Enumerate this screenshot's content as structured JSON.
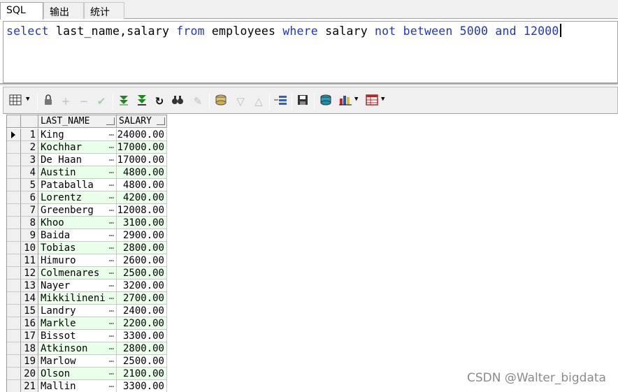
{
  "tabs": [
    "SQL",
    "输出",
    "统计"
  ],
  "sql": {
    "tokens": [
      {
        "t": "select",
        "k": true
      },
      {
        "t": " last_name,salary ",
        "k": false
      },
      {
        "t": "from",
        "k": true
      },
      {
        "t": " employees ",
        "k": false
      },
      {
        "t": "where",
        "k": true
      },
      {
        "t": " salary ",
        "k": false
      },
      {
        "t": "not",
        "k": true
      },
      {
        "t": " ",
        "k": false
      },
      {
        "t": "between",
        "k": true
      },
      {
        "t": " ",
        "k": false
      },
      {
        "t": "5000",
        "k": true
      },
      {
        "t": " ",
        "k": false
      },
      {
        "t": "and",
        "k": true
      },
      {
        "t": " ",
        "k": false
      },
      {
        "t": "12000",
        "k": true
      }
    ]
  },
  "grid": {
    "columns": [
      "LAST_NAME",
      "SALARY"
    ],
    "rows": [
      {
        "n": "1",
        "name": "King",
        "salary": "24000.00"
      },
      {
        "n": "2",
        "name": "Kochhar",
        "salary": "17000.00"
      },
      {
        "n": "3",
        "name": "De Haan",
        "salary": "17000.00"
      },
      {
        "n": "4",
        "name": "Austin",
        "salary": "4800.00"
      },
      {
        "n": "5",
        "name": "Pataballa",
        "salary": "4800.00"
      },
      {
        "n": "6",
        "name": "Lorentz",
        "salary": "4200.00"
      },
      {
        "n": "7",
        "name": "Greenberg",
        "salary": "12008.00"
      },
      {
        "n": "8",
        "name": "Khoo",
        "salary": "3100.00"
      },
      {
        "n": "9",
        "name": "Baida",
        "salary": "2900.00"
      },
      {
        "n": "10",
        "name": "Tobias",
        "salary": "2800.00"
      },
      {
        "n": "11",
        "name": "Himuro",
        "salary": "2600.00"
      },
      {
        "n": "12",
        "name": "Colmenares",
        "salary": "2500.00"
      },
      {
        "n": "13",
        "name": "Nayer",
        "salary": "3200.00"
      },
      {
        "n": "14",
        "name": "Mikkilineni",
        "salary": "2700.00"
      },
      {
        "n": "15",
        "name": "Landry",
        "salary": "2400.00"
      },
      {
        "n": "16",
        "name": "Markle",
        "salary": "2200.00"
      },
      {
        "n": "17",
        "name": "Bissot",
        "salary": "3300.00"
      },
      {
        "n": "18",
        "name": "Atkinson",
        "salary": "2800.00"
      },
      {
        "n": "19",
        "name": "Marlow",
        "salary": "2500.00"
      },
      {
        "n": "20",
        "name": "Olson",
        "salary": "2100.00"
      },
      {
        "n": "21",
        "name": "Mallin",
        "salary": "3300.00"
      }
    ]
  },
  "watermark": "CSDN @Walter_bigdata",
  "colors": {
    "keyword": "#1f36c9",
    "alt_row": "#eaffea"
  }
}
